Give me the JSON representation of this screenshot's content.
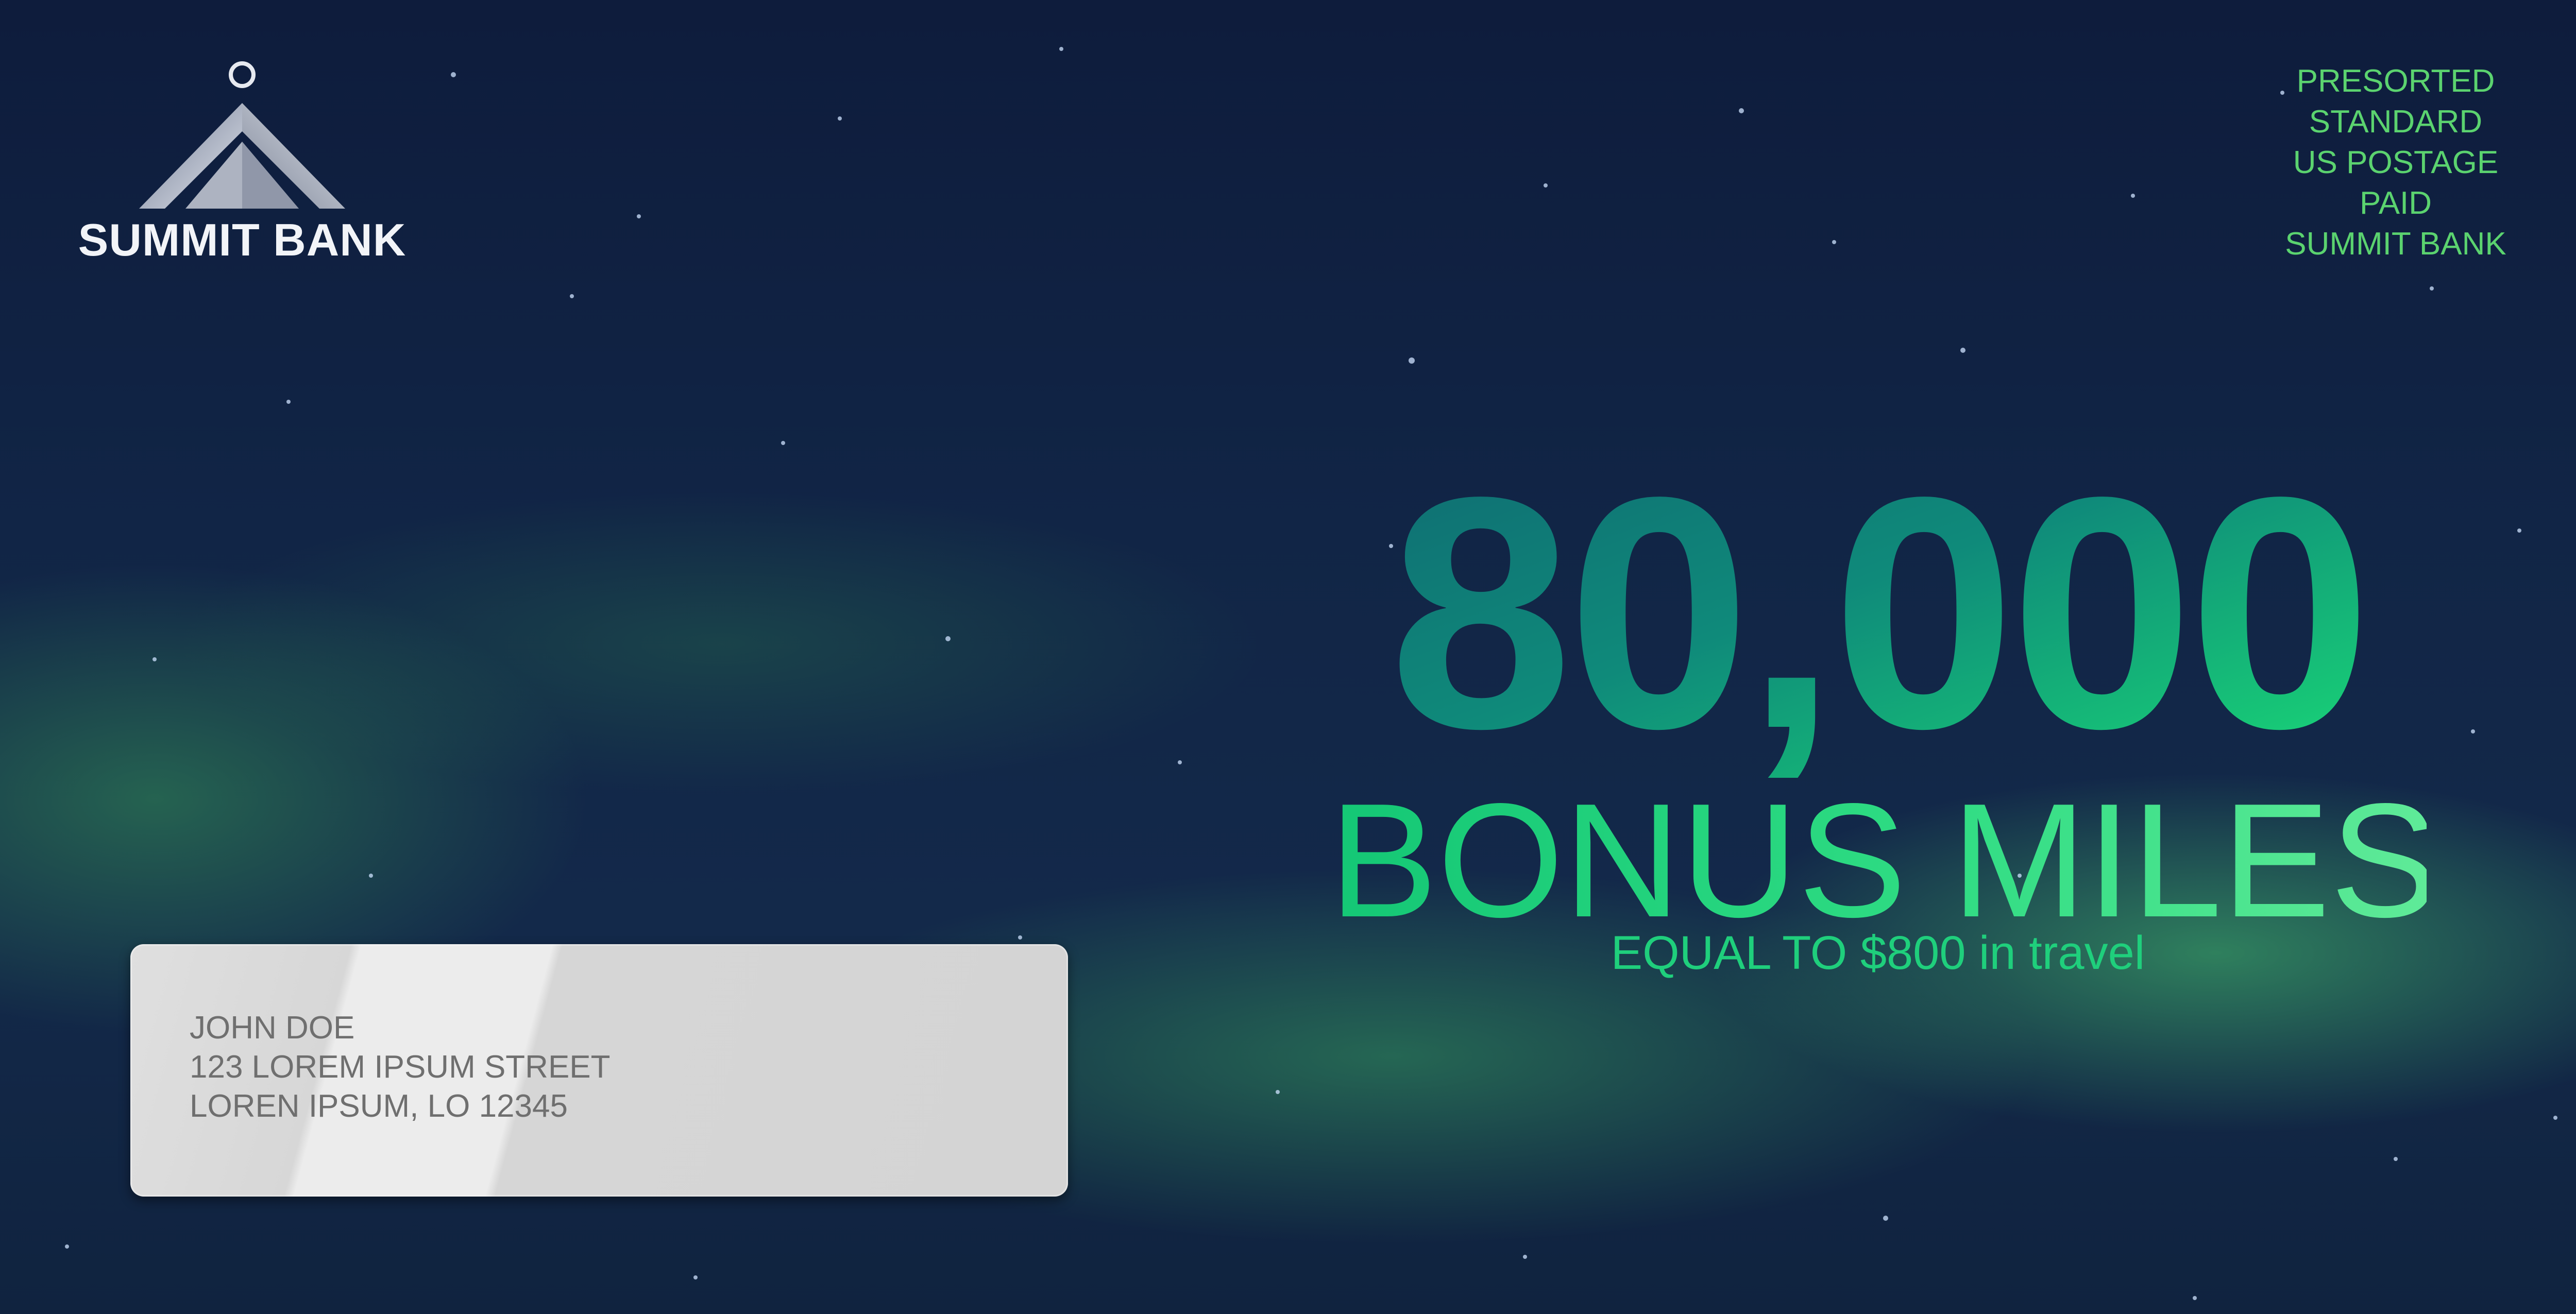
{
  "brand": {
    "name": "SUMMIT BANK"
  },
  "postage": {
    "lines": [
      "PRESORTED",
      "STANDARD",
      "US POSTAGE",
      "PAID",
      "SUMMIT BANK"
    ]
  },
  "offer": {
    "amount": "80,000",
    "label": "BONUS MILES",
    "subtitle": "EQUAL TO $800 in travel"
  },
  "recipient": {
    "name": "JOHN DOE",
    "street": "123 LOREM IPSUM STREET",
    "city_line": "LOREN IPSUM, LO 12345"
  },
  "colors": {
    "background": "#10233f",
    "aurora": "#3fbf6a",
    "accent_green": "#1fcf7c",
    "postage_green": "#5bd36f",
    "address_window": "#d8d8d8"
  }
}
